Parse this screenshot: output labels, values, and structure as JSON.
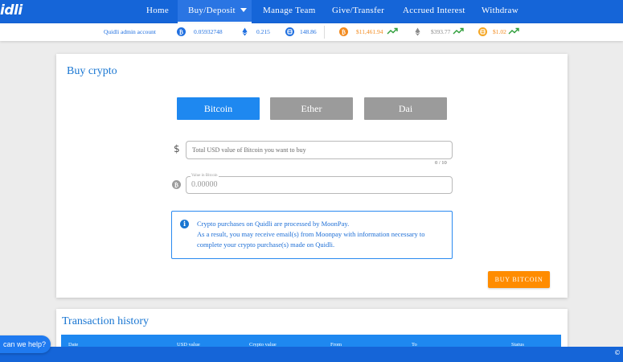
{
  "app": {
    "logo": "idli"
  },
  "nav": {
    "items": [
      {
        "label": "Home"
      },
      {
        "label": "Buy/Deposit"
      },
      {
        "label": "Manage Team"
      },
      {
        "label": "Give/Transfer"
      },
      {
        "label": "Accrued Interest"
      },
      {
        "label": "Withdraw"
      }
    ],
    "active": "Buy/Deposit"
  },
  "ticker": {
    "account_label": "Quidli admin account",
    "balances": {
      "bitcoin": "0.05932748",
      "ether": "0.215",
      "dai": "148.86"
    },
    "prices": {
      "bitcoin": "$11,461.94",
      "ether": "$393.77",
      "dai": "$1.02"
    },
    "trend_icon": "trending-up-icon"
  },
  "buy_card": {
    "title": "Buy crypto",
    "tabs": [
      {
        "label": "Bitcoin",
        "active": true
      },
      {
        "label": "Ether",
        "active": false
      },
      {
        "label": "Dai",
        "active": false
      }
    ],
    "usd_field": {
      "placeholder": "Total USD value of Bitcoin you want to buy",
      "value": "",
      "counter": "0 / 10"
    },
    "crypto_field": {
      "label": "Value in Bitcoin",
      "value": "0.00000"
    },
    "info": {
      "line1": "Crypto purchases on Quidli are processed by MoonPay.",
      "line2": "As a result, you may receive email(s) from Moonpay with information necessary to",
      "line3": "complete your crypto purchase(s) made on Quidli."
    },
    "buy_button": "BUY BITCOIN"
  },
  "history_card": {
    "title": "Transaction history",
    "columns": [
      "Date",
      "USD value",
      "Crypto value",
      "From",
      "To",
      "Status"
    ]
  },
  "help": {
    "label": "can we help?"
  },
  "footer": {
    "copyright": "©"
  },
  "colors": {
    "primary": "#1565d8",
    "accent_blue": "#1e88f0",
    "orange": "#ff8c00",
    "inactive_tab": "#9b9b9b",
    "trend_green": "#2e9e3a"
  }
}
